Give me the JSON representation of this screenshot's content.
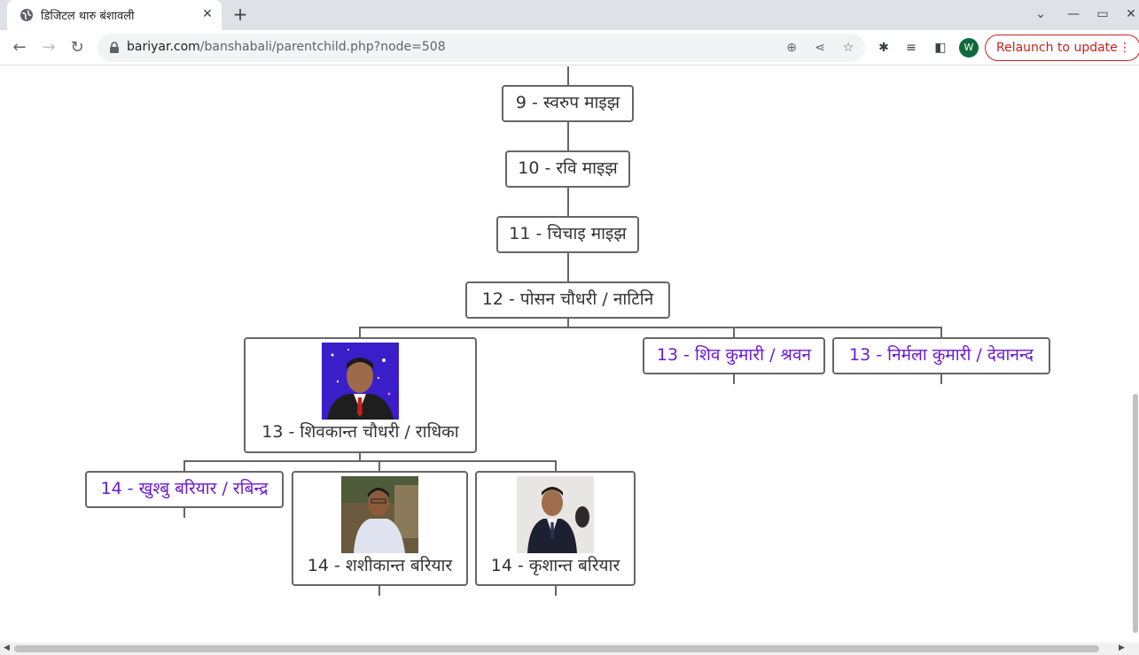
{
  "tab": {
    "title": "डिजिटल थारु बंशावली",
    "favicon": "globe-icon",
    "close": "✕"
  },
  "new_tab": "+",
  "window_controls": {
    "chevron": "⌄",
    "minimize": "—",
    "restore": "▭",
    "close": "✕"
  },
  "omnibox": {
    "domain": "bariyar.com",
    "path": "/banshabali/parentchild.php?node=508"
  },
  "profile_initial": "W",
  "relaunch": {
    "label": "Relaunch to update",
    "menu": "⋮"
  },
  "link_color": "#6a1bd6",
  "tree": {
    "n9": {
      "label": "9 - स्वरुप माइझ"
    },
    "n10": {
      "label": "10 - रवि माइझ"
    },
    "n11": {
      "label": "11 - चिचाइ माइझ"
    },
    "n12": {
      "label": "12 - पोसन चौधरी / नाटिनि"
    },
    "n13a": {
      "label": "13 - शिवकान्त चौधरी / राधिका",
      "photo": "man-in-suit-portrait"
    },
    "n13b": {
      "label": "13 - शिव कुमारी / श्रवन"
    },
    "n13c": {
      "label": "13 - निर्मला कुमारी / देवानन्द"
    },
    "n14a": {
      "label": "14 - खुश्बु बरियार / रबिन्द्र"
    },
    "n14b": {
      "label": "14 - शशीकान्त बरियार",
      "photo": "young-man-portrait"
    },
    "n14c": {
      "label": "14 - कृशान्त बरियार",
      "photo": "student-in-blazer-portrait"
    }
  }
}
